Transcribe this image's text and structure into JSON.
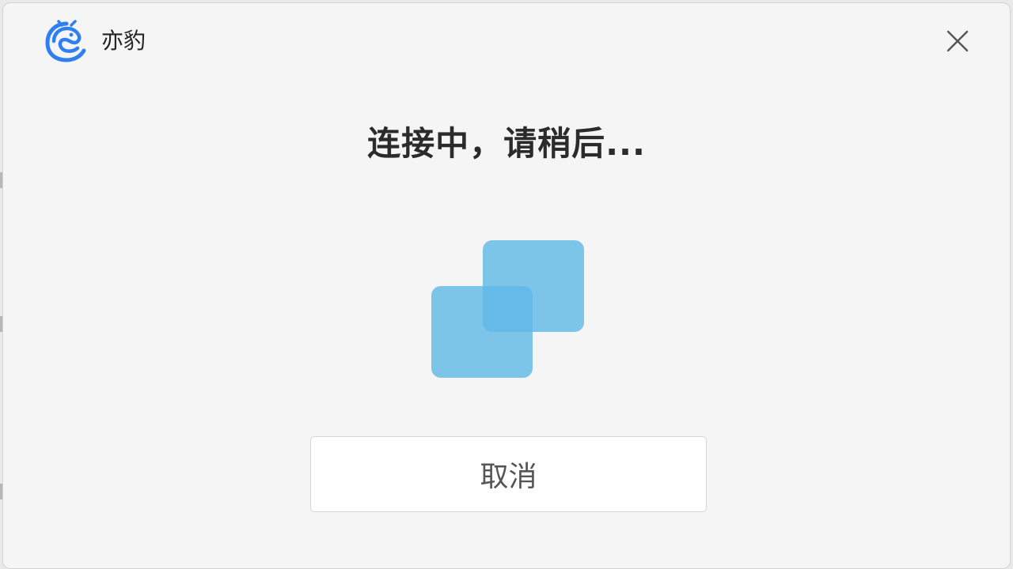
{
  "window": {
    "app_name": "亦豹",
    "close_icon": "close-icon",
    "logo_icon": "leopard-logo-icon"
  },
  "status": {
    "title": "连接中，请稍后..."
  },
  "loading": {
    "icon": "overlapping-squares-icon",
    "color": "#5fb8e6"
  },
  "actions": {
    "cancel_label": "取消"
  }
}
